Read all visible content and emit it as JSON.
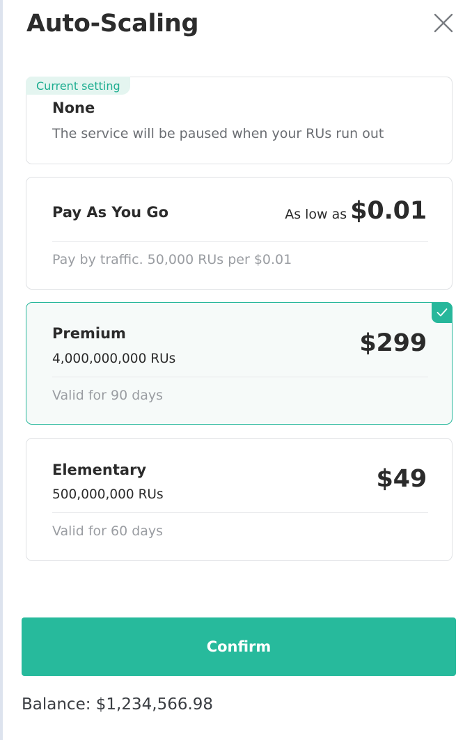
{
  "dialog": {
    "title": "Auto-Scaling",
    "close_icon": "close-icon"
  },
  "plans": {
    "none": {
      "tag": "Current setting",
      "name": "None",
      "description": "The service will be paused when your RUs run out"
    },
    "pay_as_you_go": {
      "name": "Pay As You Go",
      "price_prefix": "As low as",
      "price": "$0.01",
      "note": "Pay by traffic. 50,000 RUs per $0.01"
    },
    "premium": {
      "name": "Premium",
      "rus": "4,000,000,000 RUs",
      "price": "$299",
      "validity": "Valid for 90 days",
      "selected": true,
      "check_icon": "checkmark-icon"
    },
    "elementary": {
      "name": "Elementary",
      "rus": "500,000,000 RUs",
      "price": "$49",
      "validity": "Valid for 60 days",
      "selected": false
    }
  },
  "actions": {
    "confirm_label": "Confirm"
  },
  "balance": "Balance: $1,234,566.98",
  "colors": {
    "accent": "#27ba9c",
    "selected_bg": "#f6faf9",
    "tag_bg": "#e4f5f0",
    "border": "#dfe1e4"
  }
}
